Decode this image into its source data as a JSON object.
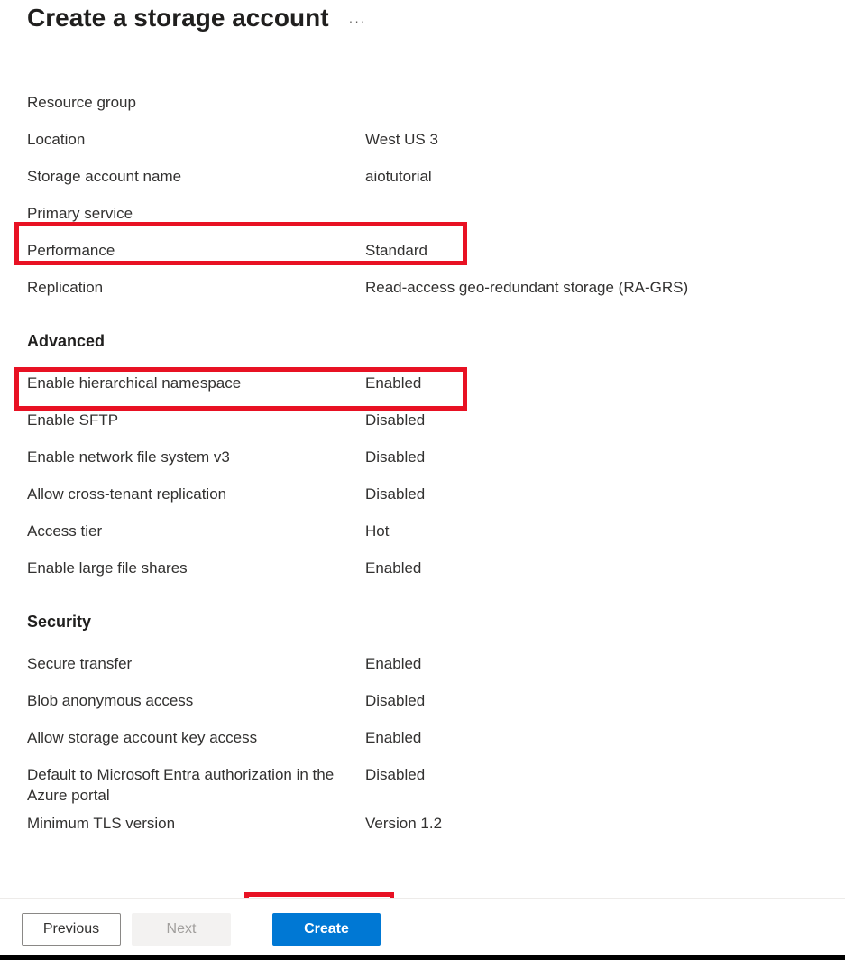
{
  "header": {
    "title": "Create a storage account"
  },
  "basics": {
    "rows": [
      {
        "label": "Resource group",
        "value": ""
      },
      {
        "label": "Location",
        "value": "West US 3"
      },
      {
        "label": "Storage account name",
        "value": "aiotutorial"
      },
      {
        "label": "Primary service",
        "value": ""
      },
      {
        "label": "Performance",
        "value": "Standard"
      },
      {
        "label": "Replication",
        "value": "Read-access geo-redundant storage (RA-GRS)"
      }
    ]
  },
  "advanced": {
    "heading": "Advanced",
    "rows": [
      {
        "label": "Enable hierarchical namespace",
        "value": "Enabled"
      },
      {
        "label": "Enable SFTP",
        "value": "Disabled"
      },
      {
        "label": "Enable network file system v3",
        "value": "Disabled"
      },
      {
        "label": "Allow cross-tenant replication",
        "value": "Disabled"
      },
      {
        "label": "Access tier",
        "value": "Hot"
      },
      {
        "label": "Enable large file shares",
        "value": "Enabled"
      }
    ]
  },
  "security": {
    "heading": "Security",
    "rows": [
      {
        "label": "Secure transfer",
        "value": "Enabled"
      },
      {
        "label": "Blob anonymous access",
        "value": "Disabled"
      },
      {
        "label": "Allow storage account key access",
        "value": "Enabled"
      },
      {
        "label": "Default to Microsoft Entra authorization in the Azure portal",
        "value": "Disabled"
      },
      {
        "label": "Minimum TLS version",
        "value": "Version 1.2"
      }
    ]
  },
  "footer": {
    "previous": "Previous",
    "next": "Next",
    "create": "Create"
  }
}
